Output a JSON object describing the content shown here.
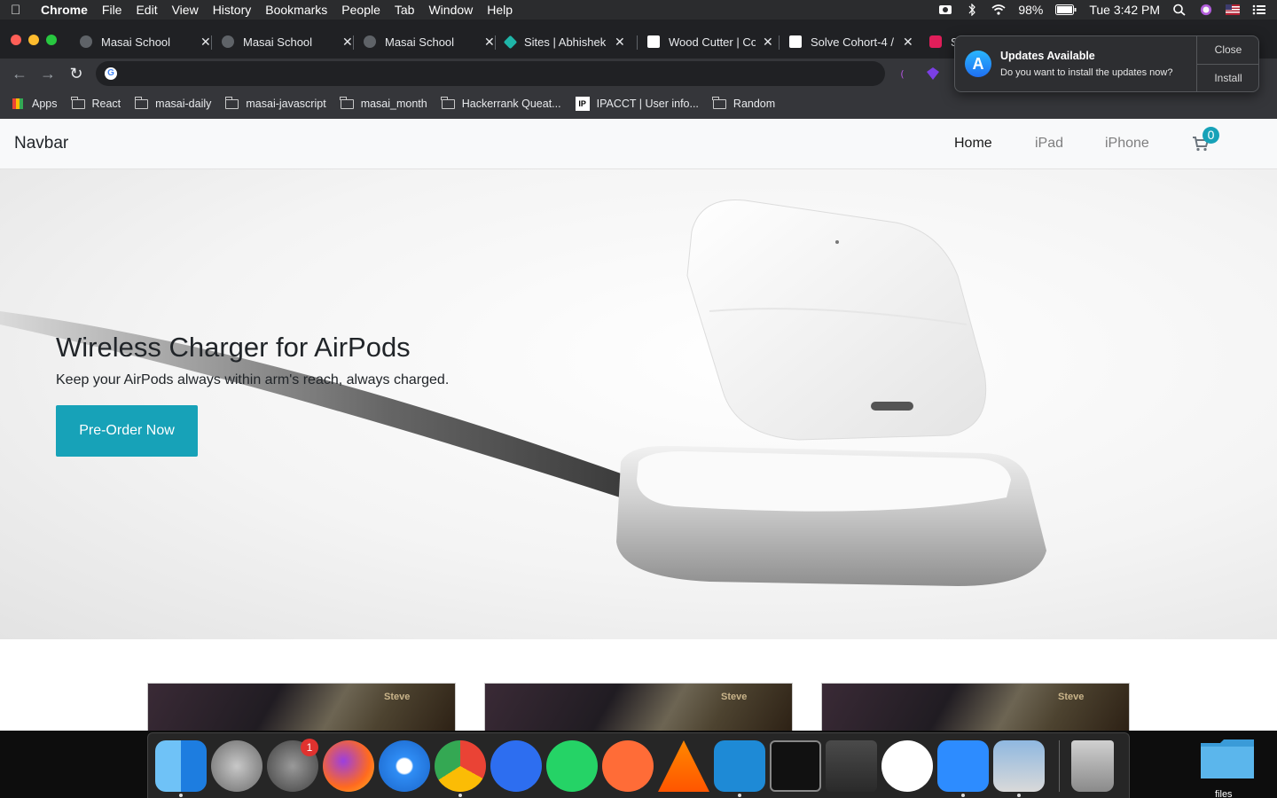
{
  "menubar": {
    "app_name": "Chrome",
    "menus": [
      "File",
      "Edit",
      "View",
      "History",
      "Bookmarks",
      "People",
      "Tab",
      "Window",
      "Help"
    ],
    "battery": "98%",
    "clock": "Tue 3:42 PM"
  },
  "browser": {
    "tabs": [
      {
        "title": "Masai School"
      },
      {
        "title": "Masai School"
      },
      {
        "title": "Masai School"
      },
      {
        "title": "Sites | Abhishek"
      },
      {
        "title": "Wood Cutter | Co"
      },
      {
        "title": "Solve Cohort-4 /"
      },
      {
        "title": "S"
      }
    ],
    "address": "",
    "bookmarks": [
      {
        "label": "Apps",
        "icon": "apps-icon"
      },
      {
        "label": "React",
        "icon": "folder-icon"
      },
      {
        "label": "masai-daily",
        "icon": "folder-icon"
      },
      {
        "label": "masai-javascript",
        "icon": "folder-icon"
      },
      {
        "label": "masai_month",
        "icon": "folder-icon"
      },
      {
        "label": "Hackerrank Queat...",
        "icon": "folder-icon"
      },
      {
        "label": "IPACCT | User info...",
        "icon": "ipacct-icon"
      },
      {
        "label": "Random",
        "icon": "folder-icon"
      }
    ]
  },
  "notification": {
    "title": "Updates Available",
    "message": "Do you want to install the updates now?",
    "close_label": "Close",
    "install_label": "Install"
  },
  "page": {
    "brand": "Navbar",
    "nav": [
      "Home",
      "iPad",
      "iPhone"
    ],
    "cart_count": "0",
    "hero": {
      "title": "Wireless Charger for AirPods",
      "subtitle": "Keep your AirPods always within arm's reach, always charged.",
      "cta": "Pre-Order Now"
    },
    "cards": [
      {
        "caption": "Steve"
      },
      {
        "caption": "Steve"
      },
      {
        "caption": "Steve"
      }
    ],
    "accent_color": "#17a2b8"
  },
  "dock": {
    "apps": [
      "finder",
      "launchpad",
      "system-preferences",
      "firefox",
      "safari",
      "chrome",
      "zoom-player",
      "whatsapp",
      "postman",
      "vlc",
      "vscode",
      "terminal",
      "sublime-text",
      "mongodb-compass",
      "zoom",
      "preview",
      "trash"
    ],
    "system_preferences_badge": "1"
  },
  "desktop": {
    "folder_label": "files"
  }
}
